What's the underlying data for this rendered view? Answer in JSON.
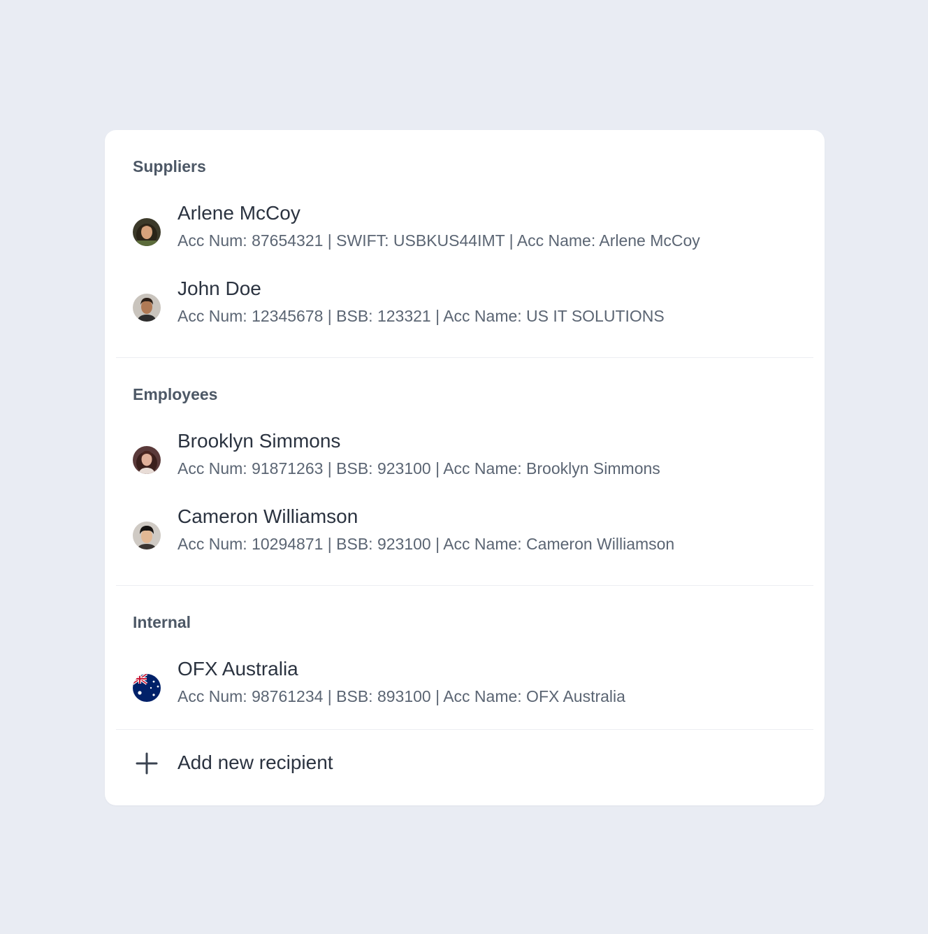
{
  "sections": [
    {
      "title": "Suppliers",
      "items": [
        {
          "name": "Arlene McCoy",
          "details": "Acc Num: 87654321 | SWIFT: USBKUS44IMT | Acc Name: Arlene McCoy",
          "avatar": "woman-avatar"
        },
        {
          "name": "John Doe",
          "details": "Acc Num: 12345678 | BSB: 123321 | Acc Name: US IT SOLUTIONS",
          "avatar": "man-avatar"
        }
      ]
    },
    {
      "title": "Employees",
      "items": [
        {
          "name": "Brooklyn Simmons",
          "details": "Acc Num: 91871263 | BSB: 923100 | Acc Name: Brooklyn Simmons",
          "avatar": "woman-avatar"
        },
        {
          "name": "Cameron Williamson",
          "details": "Acc Num: 10294871 | BSB: 923100 | Acc Name: Cameron Williamson",
          "avatar": "man-avatar"
        }
      ]
    },
    {
      "title": "Internal",
      "items": [
        {
          "name": "OFX Australia",
          "details": "Acc Num: 98761234 | BSB: 893100 | Acc Name: OFX Australia",
          "avatar": "australia-flag-icon"
        }
      ]
    }
  ],
  "add_recipient": {
    "label": "Add new recipient",
    "icon": "plus-icon"
  },
  "colors": {
    "background": "#e9ecf3",
    "card": "#ffffff",
    "heading": "#4d5866",
    "name": "#2b3340",
    "details": "#5b6573"
  }
}
